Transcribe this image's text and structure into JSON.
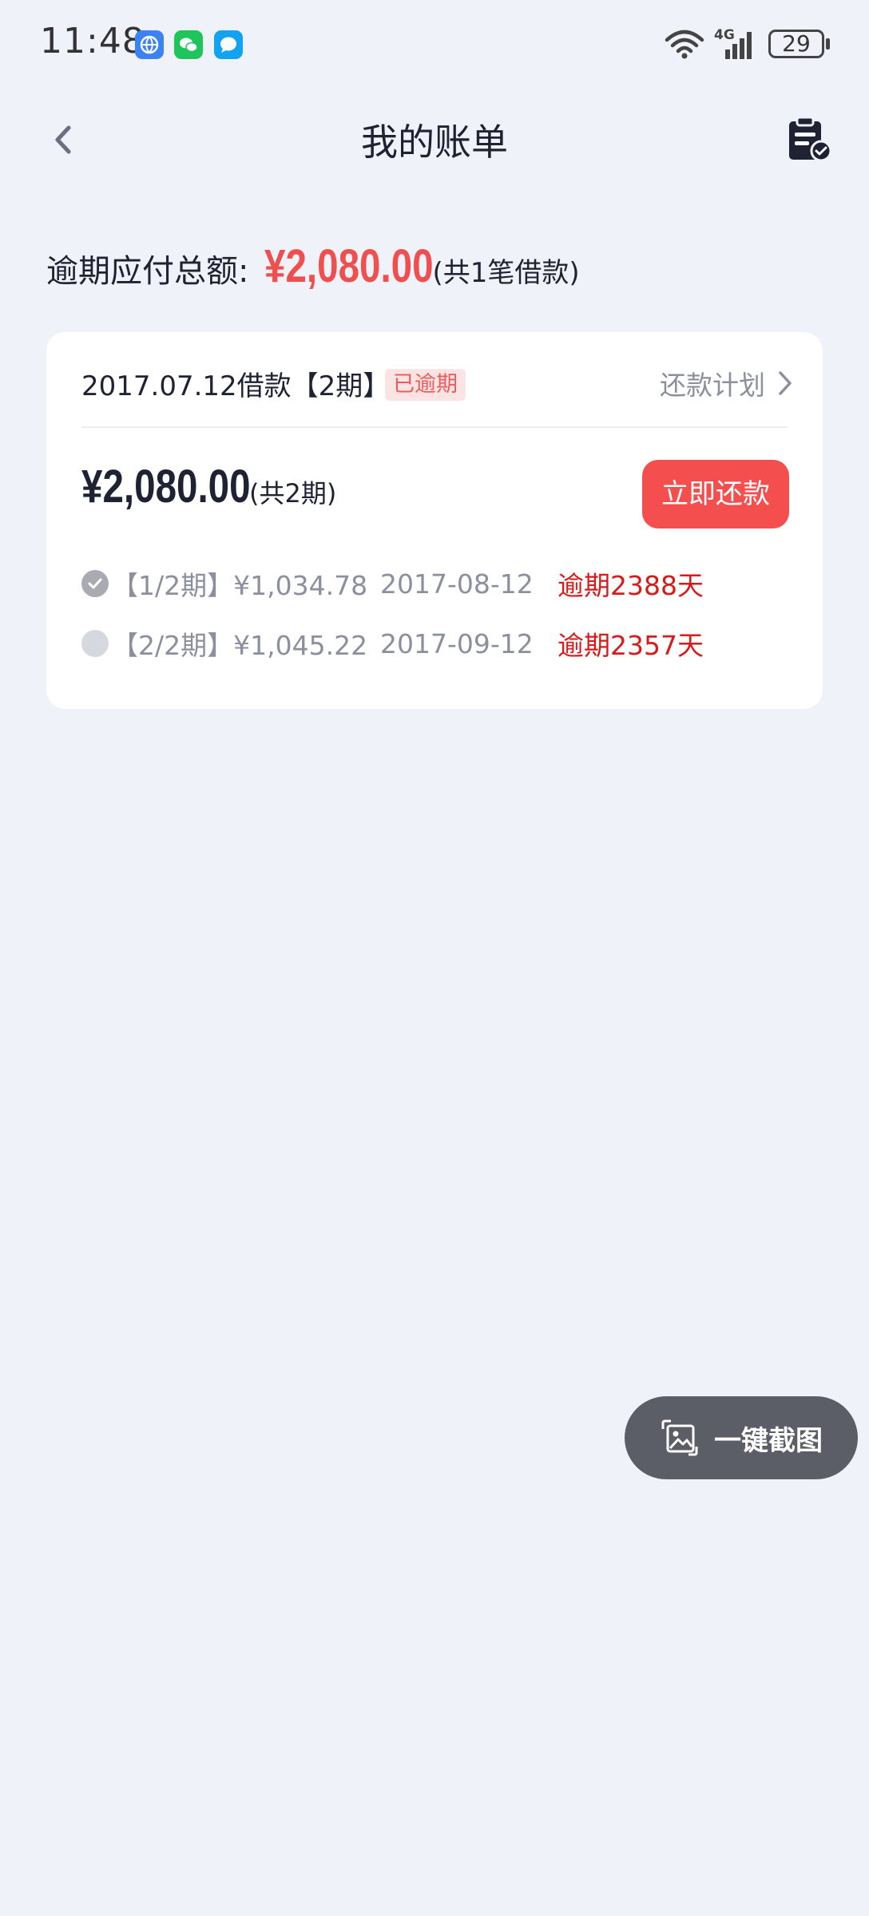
{
  "status_bar": {
    "time": "11:48",
    "network": "4G",
    "battery": "29",
    "app_icons": [
      "browser-icon",
      "wechat-icon",
      "message-icon"
    ]
  },
  "nav": {
    "title": "我的账单"
  },
  "summary": {
    "label": "逾期应付总额:",
    "amount": "¥2,080.00",
    "count": "(共1笔借款)"
  },
  "loan": {
    "title": "2017.07.12借款【2期】",
    "badge": "已逾期",
    "plan_link": "还款计划",
    "amount": "¥2,080.00",
    "amount_sub": "(共2期)",
    "pay_button": "立即还款",
    "installments": [
      {
        "label": "【1/2期】¥1,034.78",
        "date": "2017-08-12",
        "overdue": "逾期2388天",
        "status": "done"
      },
      {
        "label": "【2/2期】¥1,045.22",
        "date": "2017-09-12",
        "overdue": "逾期2357天",
        "status": "pending"
      }
    ]
  },
  "floating": {
    "screenshot_label": "一键截图"
  },
  "colors": {
    "accent_red": "#f44f4e",
    "amount_red": "#ef4f4f",
    "overdue_red": "#d91a1a",
    "background": "#eff2f9"
  }
}
